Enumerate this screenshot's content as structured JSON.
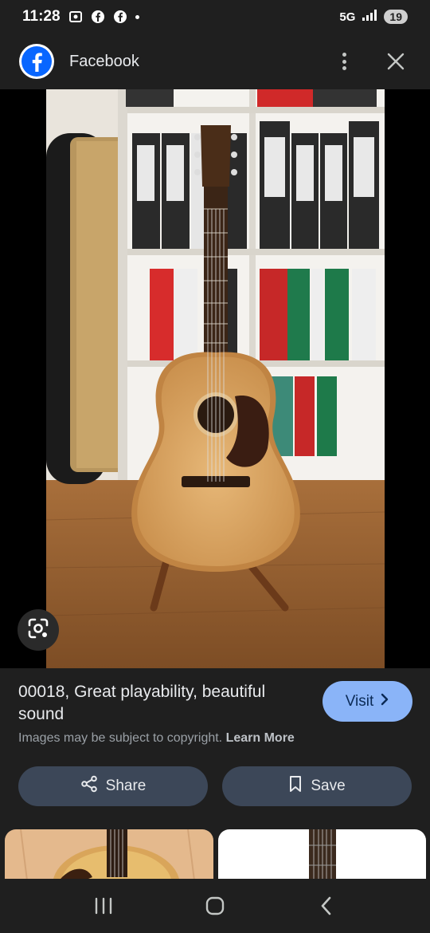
{
  "status_bar": {
    "time": "11:28",
    "network": "5G",
    "battery": "19"
  },
  "app_bar": {
    "title": "Facebook",
    "logo_icon": "facebook-logo-icon",
    "more_icon": "more-vert-icon",
    "close_icon": "close-icon"
  },
  "image": {
    "subject": "acoustic guitar on stand in front of bookshelf with binders",
    "lens_icon": "google-lens-icon"
  },
  "result": {
    "title": "00018, Great playability, beautiful sound",
    "visit_label": "Visit",
    "copyright_text": "Images may be subject to copyright.",
    "learn_more": "Learn More",
    "share_label": "Share",
    "save_label": "Save"
  },
  "nav_bar": {
    "recents_icon": "recents-icon",
    "home_icon": "home-icon",
    "back_icon": "back-icon"
  },
  "colors": {
    "background": "#1f1f1f",
    "accent": "#8ab4f8",
    "button_bg": "#3c4758",
    "facebook_blue": "#0866ff"
  }
}
